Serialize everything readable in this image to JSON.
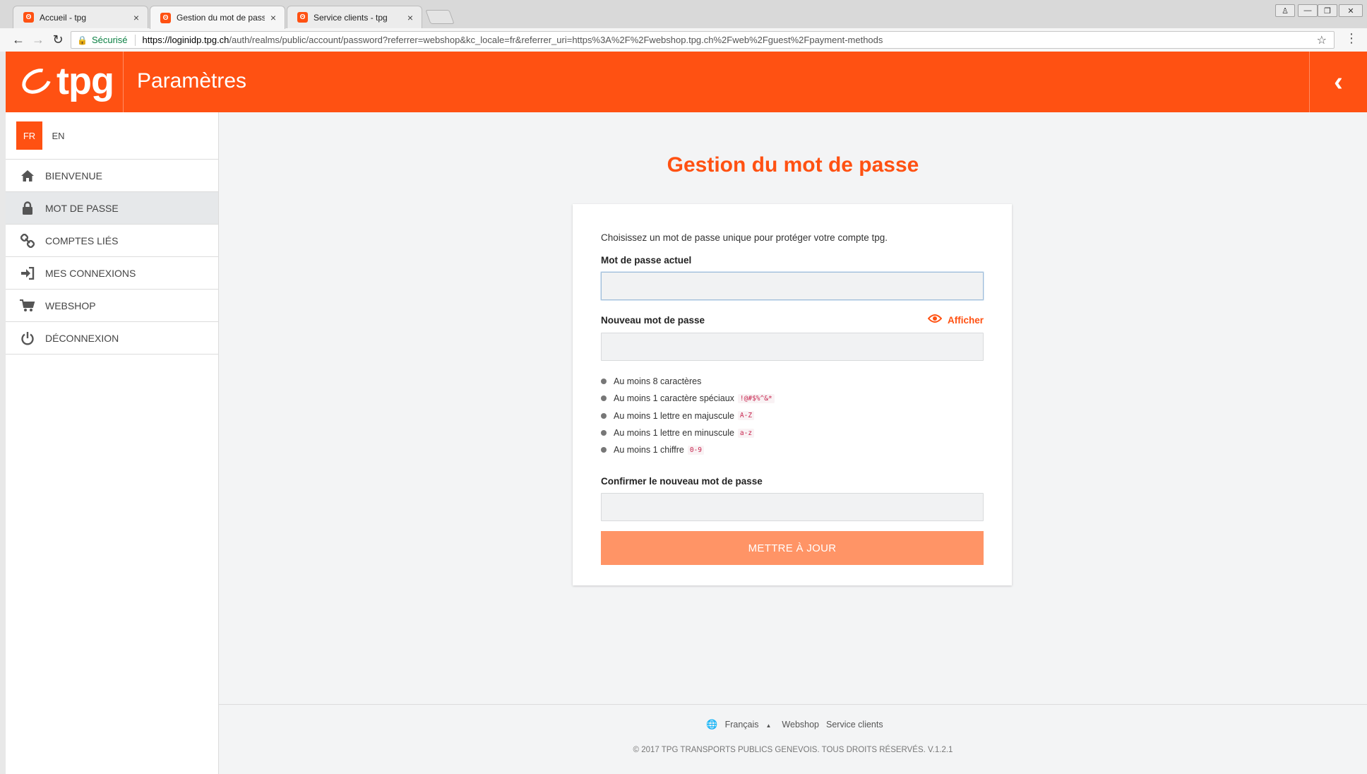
{
  "browser": {
    "tabs": [
      {
        "title": "Accueil - tpg",
        "active": false
      },
      {
        "title": "Gestion du mot de passe",
        "active": true
      },
      {
        "title": "Service clients - tpg",
        "active": false
      }
    ],
    "tab_close": "×",
    "secure_label": "Sécurisé",
    "url_domain": "https://loginidp.tpg.ch",
    "url_rest": "/auth/realms/public/account/password?referrer=webshop&kc_locale=fr&referrer_uri=https%3A%2F%2Fwebshop.tpg.ch%2Fweb%2Fguest%2Fpayment-methods"
  },
  "header": {
    "logo": "tpg",
    "title": "Paramètres",
    "back_icon": "chevron-left-icon"
  },
  "sidebar": {
    "languages": [
      "FR",
      "EN"
    ],
    "items": [
      {
        "label": "BIENVENUE",
        "icon": "home-icon",
        "active": false
      },
      {
        "label": "MOT DE PASSE",
        "icon": "lock-icon",
        "active": true
      },
      {
        "label": "COMPTES LIÉS",
        "icon": "link-icon",
        "active": false
      },
      {
        "label": "MES CONNEXIONS",
        "icon": "sign-in-icon",
        "active": false
      },
      {
        "label": "WEBSHOP",
        "icon": "cart-icon",
        "active": false
      },
      {
        "label": "DÉCONNEXION",
        "icon": "power-icon",
        "active": false
      }
    ]
  },
  "main": {
    "title": "Gestion du mot de passe",
    "intro": "Choisissez un mot de passe unique pour protéger votre compte tpg.",
    "current_label": "Mot de passe actuel",
    "new_label": "Nouveau mot de passe",
    "show_label": "Afficher",
    "rules": [
      {
        "text": "Au moins 8 caractères",
        "code": ""
      },
      {
        "text": "Au moins 1 caractère spéciaux",
        "code": "!@#$%^&*"
      },
      {
        "text": "Au moins 1 lettre en majuscule",
        "code": "A-Z"
      },
      {
        "text": "Au moins 1 lettre en minuscule",
        "code": "a-z"
      },
      {
        "text": "Au moins 1 chiffre",
        "code": "0-9"
      }
    ],
    "confirm_label": "Confirmer le nouveau mot de passe",
    "submit_label": "METTRE À JOUR"
  },
  "footer": {
    "language": "Français",
    "links": [
      "Webshop",
      "Service clients"
    ],
    "copyright": "© 2017 TPG TRANSPORTS PUBLICS GENEVOIS. TOUS DROITS RÉSERVÉS. V.1.2.1"
  },
  "colors": {
    "brand": "#ff5112",
    "button": "#ff9466",
    "active_nav": "#e6e8ea"
  }
}
